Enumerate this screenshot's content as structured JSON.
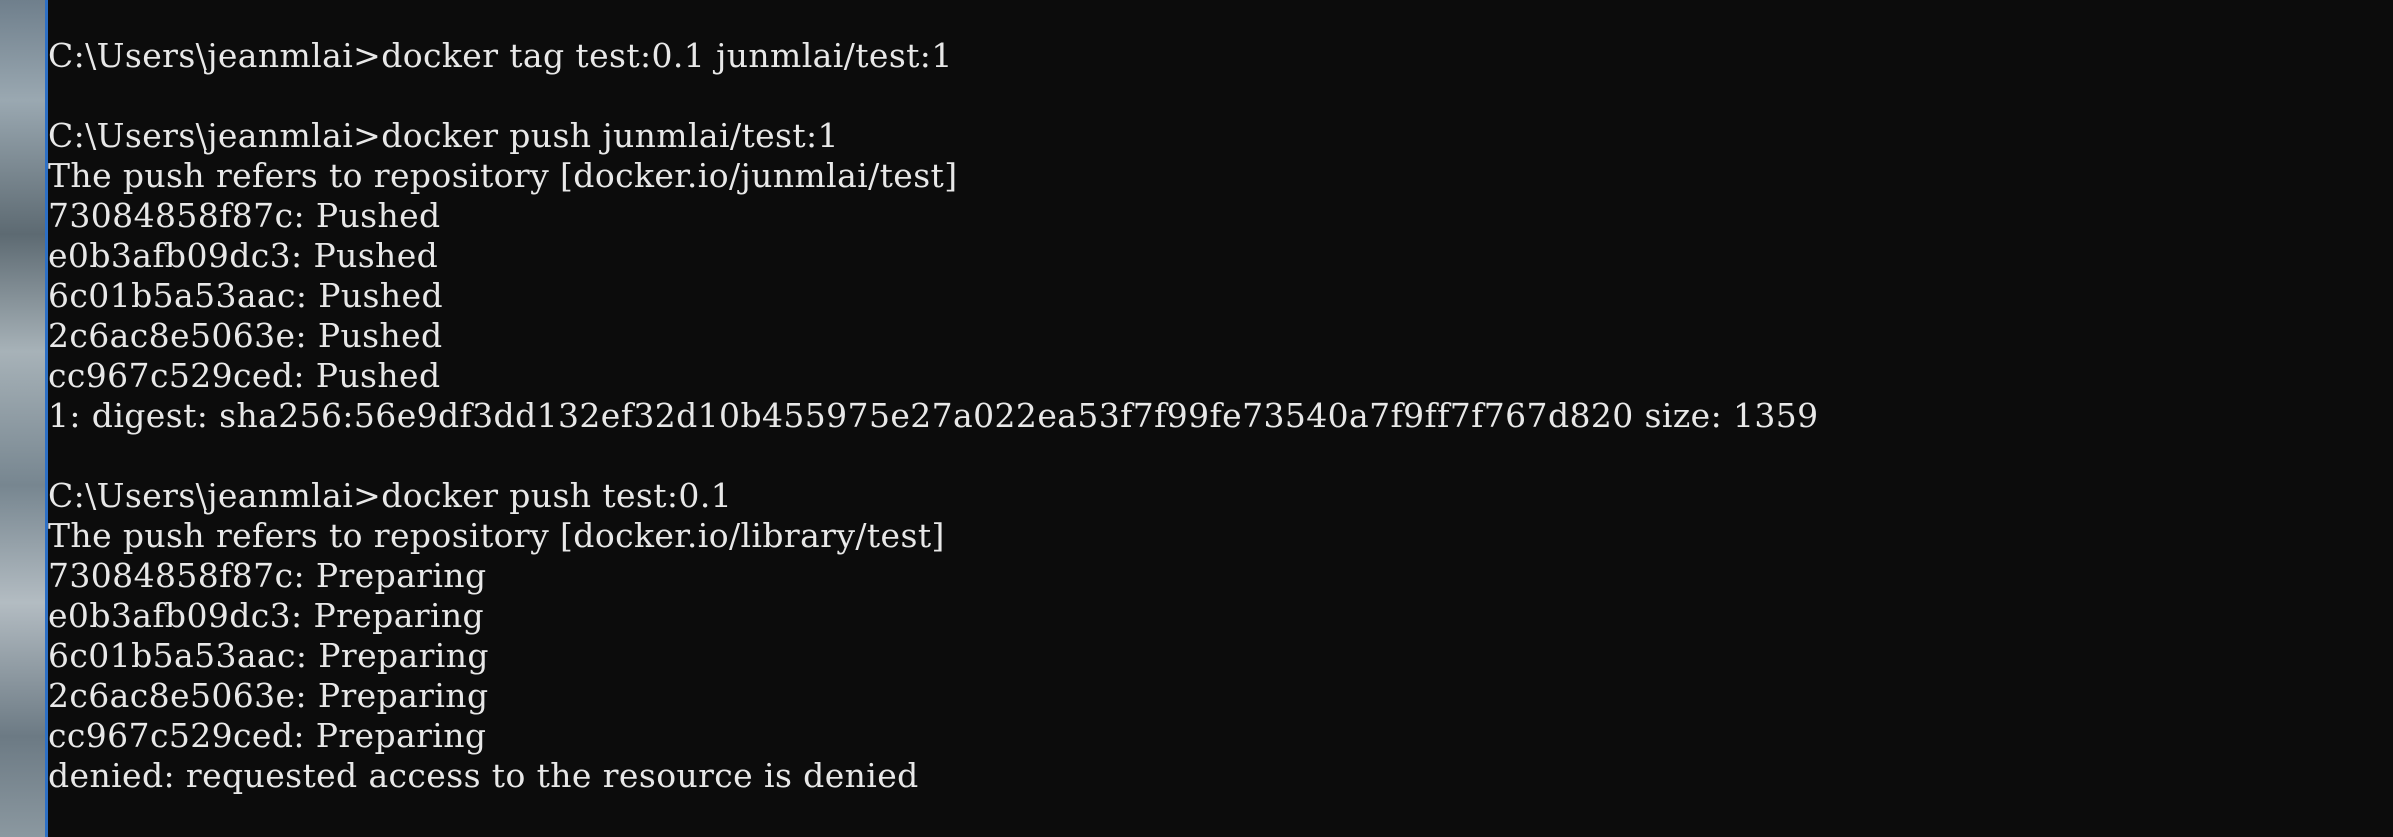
{
  "terminal": {
    "lines": [
      "C:\\Users\\jeanmlai>docker tag test:0.1 junmlai/test:1",
      "",
      "C:\\Users\\jeanmlai>docker push junmlai/test:1",
      "The push refers to repository [docker.io/junmlai/test]",
      "73084858f87c: Pushed",
      "e0b3afb09dc3: Pushed",
      "6c01b5a53aac: Pushed",
      "2c6ac8e5063e: Pushed",
      "cc967c529ced: Pushed",
      "1: digest: sha256:56e9df3dd132ef32d10b455975e27a022ea53f7f99fe73540a7f9ff7f767d820 size: 1359",
      "",
      "C:\\Users\\jeanmlai>docker push test:0.1",
      "The push refers to repository [docker.io/library/test]",
      "73084858f87c: Preparing",
      "e0b3afb09dc3: Preparing",
      "6c01b5a53aac: Preparing",
      "2c6ac8e5063e: Preparing",
      "cc967c529ced: Preparing",
      "denied: requested access to the resource is denied"
    ]
  },
  "colors": {
    "background": "#0c0c0c",
    "text": "#e8e8e8",
    "window_edge": "#2d6fc4"
  }
}
